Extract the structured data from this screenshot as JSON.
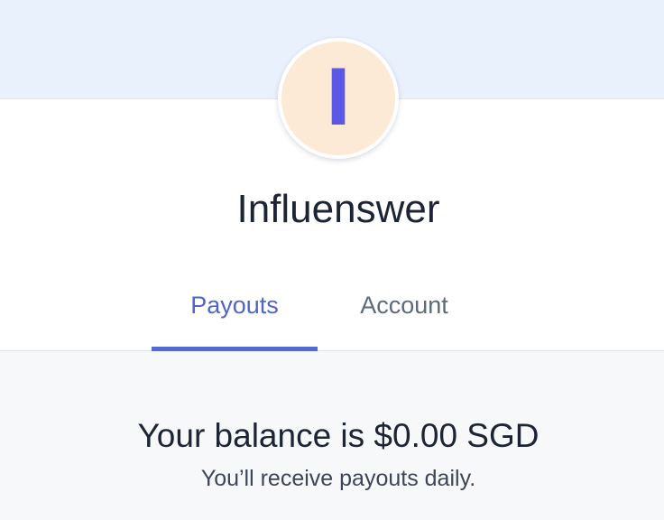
{
  "profile": {
    "avatar_letter": "I",
    "name": "Influenswer"
  },
  "tabs": [
    {
      "label": "Payouts",
      "active": true
    },
    {
      "label": "Account",
      "active": false
    }
  ],
  "balance": {
    "heading": "Your balance is $0.00 SGD",
    "subtext": "You’ll receive payouts daily."
  },
  "colors": {
    "banner": "#e9f1fd",
    "avatar_bg": "#fdead6",
    "avatar_letter": "#5c58e6",
    "active_tab": "#5469d4",
    "inactive_tab": "#5e6a7c",
    "content_bg": "#f6f8fa"
  }
}
